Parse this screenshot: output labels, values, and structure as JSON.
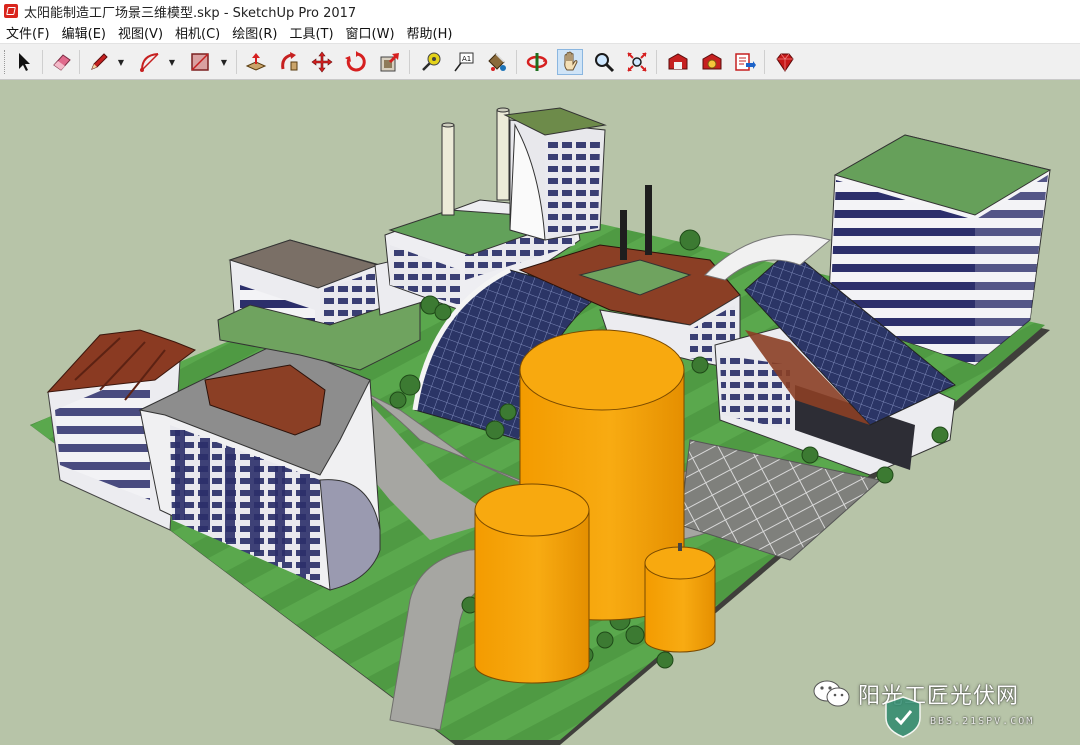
{
  "window": {
    "title": "太阳能制造工厂场景三维模型.skp - SketchUp Pro 2017"
  },
  "menu": {
    "items": [
      {
        "label": "文件(F)"
      },
      {
        "label": "编辑(E)"
      },
      {
        "label": "视图(V)"
      },
      {
        "label": "相机(C)"
      },
      {
        "label": "绘图(R)"
      },
      {
        "label": "工具(T)"
      },
      {
        "label": "窗口(W)"
      },
      {
        "label": "帮助(H)"
      }
    ]
  },
  "toolbar": {
    "tools": [
      "select-icon",
      "eraser-icon",
      "pencil-icon",
      "arc-icon",
      "rectangle-icon",
      "push-pull-icon",
      "follow-me-icon",
      "move-icon",
      "rotate-icon",
      "offset-icon",
      "tape-measure-icon",
      "text-icon",
      "paint-bucket-icon",
      "orbit-icon",
      "pan-icon",
      "zoom-icon",
      "zoom-extents-icon",
      "warehouse-icon",
      "extension-warehouse-icon",
      "share-model-icon",
      "ruby-icon"
    ]
  },
  "watermark": {
    "text": "阳光工匠光伏网",
    "sub": "BBS.21SPV.COM"
  },
  "colors": {
    "background": "#b7c4a8",
    "grass": "#4f9a43",
    "tank": "#f7a70a",
    "road": "#a6a6a2"
  }
}
